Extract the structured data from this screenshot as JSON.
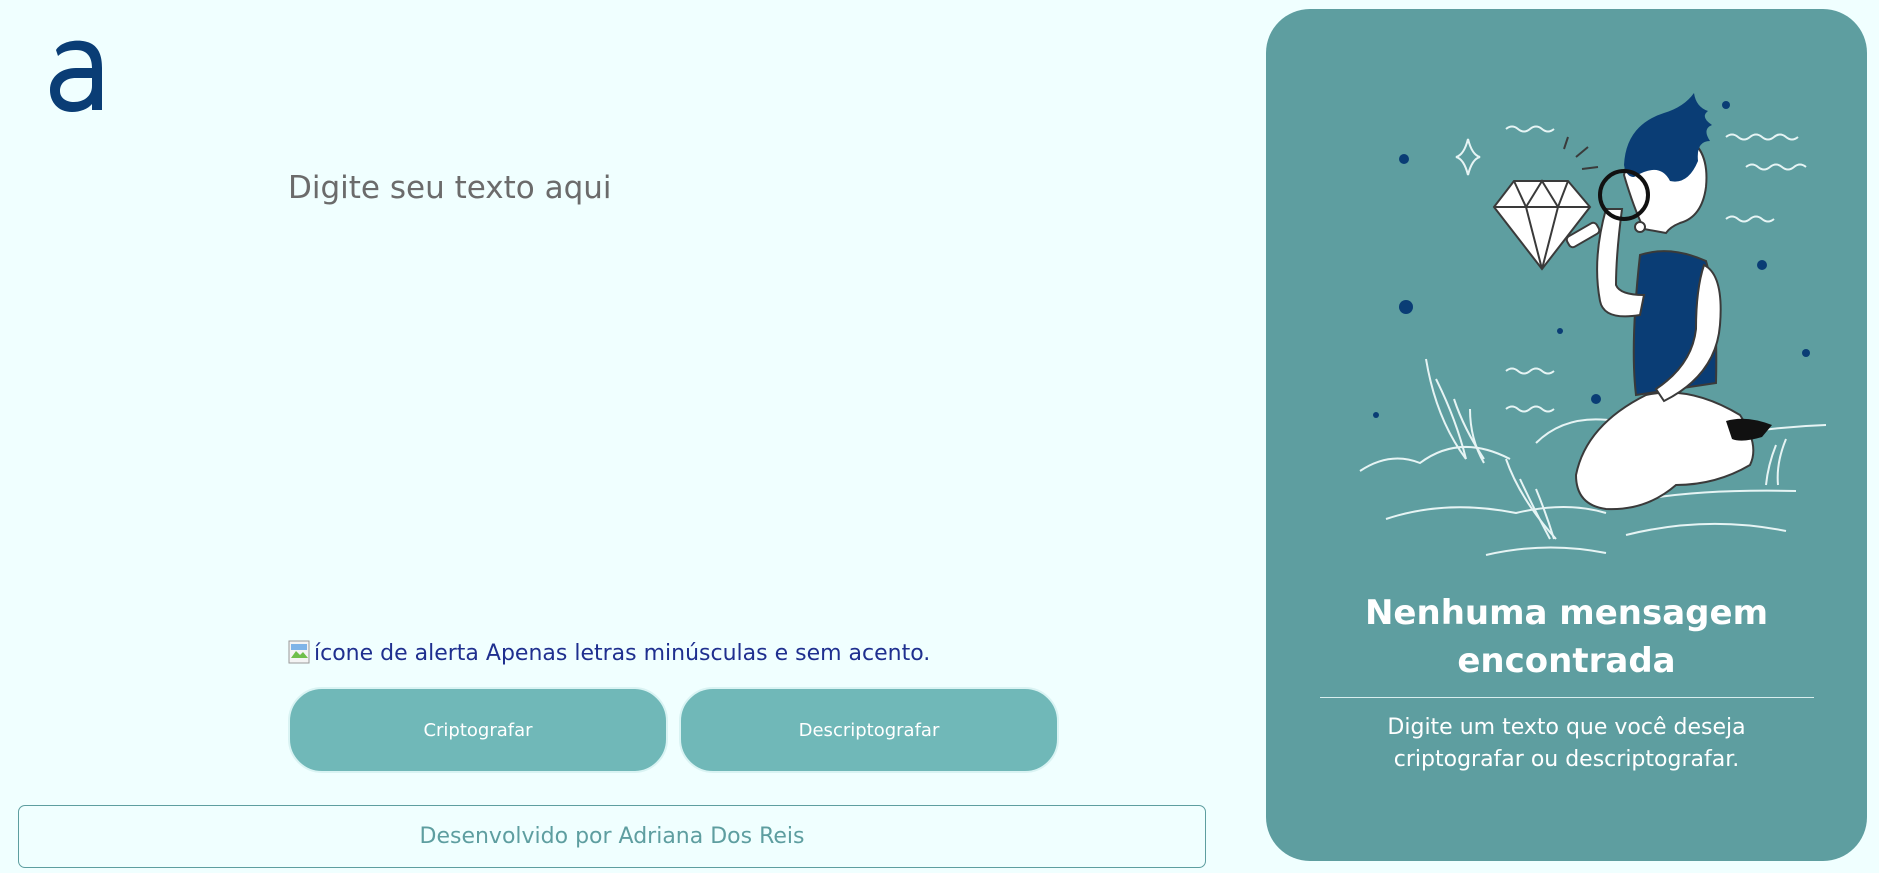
{
  "brand": {
    "logo_icon": "letter-a-logo",
    "color": "#0a3d75"
  },
  "input": {
    "placeholder": "Digite seu texto aqui",
    "value": ""
  },
  "alert": {
    "icon_alt": "ícone de alerta",
    "message": "Apenas letras minúsculas e sem acento."
  },
  "buttons": {
    "encrypt_label": "Criptografar",
    "decrypt_label": "Descriptografar"
  },
  "footer": {
    "text": "Desenvolvido por Adriana Dos Reis"
  },
  "output_panel": {
    "illustration_icon": "person-with-magnifier-diamond-illustration",
    "title": "Nenhuma mensagem encontrada",
    "description": "Digite um texto que você deseja criptografar ou descriptografar."
  },
  "colors": {
    "background": "#f0ffff",
    "panel": "#5e9ea0",
    "button": "#70b8b8",
    "accent_text": "#1f2f8f"
  }
}
